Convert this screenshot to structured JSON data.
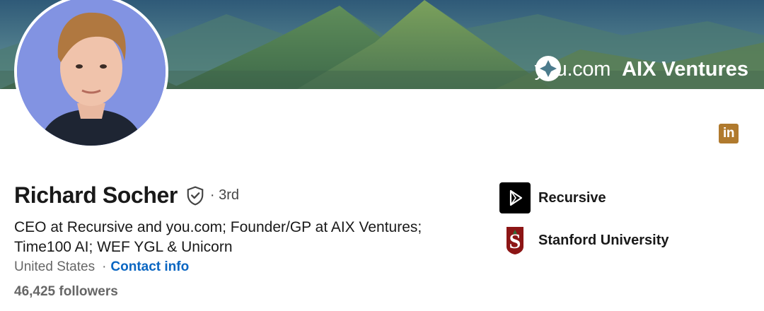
{
  "banner": {
    "brand_one": "you.com",
    "brand_two": "AIX Ventures"
  },
  "profile": {
    "name": "Richard Socher",
    "degree": "· 3rd",
    "headline": "CEO at Recursive and you.com; Founder/GP at AIX Ventures; Time100 AI; WEF YGL & Unicorn",
    "location": "United States",
    "separator": "·",
    "contact_link": "Contact info",
    "followers": "46,425 followers"
  },
  "organizations": [
    {
      "name": "Recursive",
      "icon": "recursive-logo-icon"
    },
    {
      "name": "Stanford University",
      "icon": "stanford-logo-icon"
    }
  ],
  "social": {
    "icon": "linkedin-icon",
    "label": "in"
  },
  "colors": {
    "link": "#0a66c2",
    "linkedin": "#b07a2e",
    "stanford": "#8c1515"
  }
}
